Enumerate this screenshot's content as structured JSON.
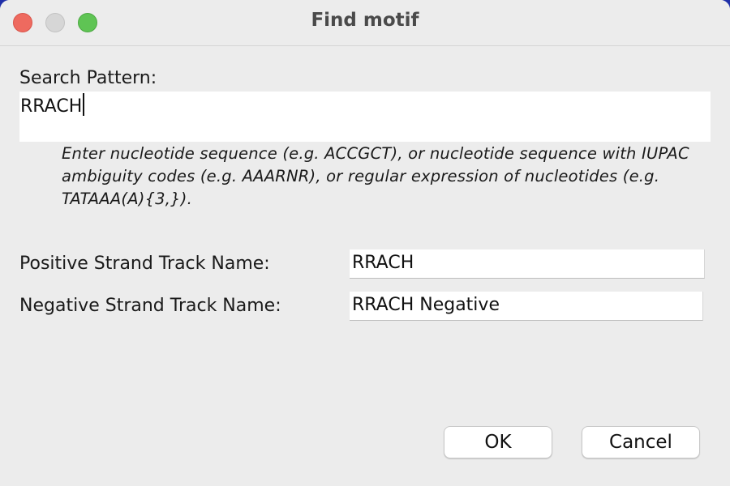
{
  "window": {
    "title": "Find motif",
    "controls": [
      "close",
      "minimize",
      "zoom"
    ]
  },
  "search": {
    "label": "Search Pattern:",
    "value": "RRACH",
    "hint": "Enter nucleotide sequence (e.g. ACCGCT),  or nucleotide sequence with IUPAC ambiguity codes (e.g. AAARNR),  or regular expression of nucleotides (e.g. TATAAA(A){3,})."
  },
  "positive_track": {
    "label": "Positive Strand Track Name:",
    "value": "RRACH"
  },
  "negative_track": {
    "label": "Negative Strand Track Name:",
    "value": "RRACH Negative"
  },
  "buttons": {
    "ok": "OK",
    "cancel": "Cancel"
  },
  "colors": {
    "close": "#ee6a5f",
    "minimize": "#d6d6d6",
    "zoom": "#5fc454",
    "window_bg": "#ececec"
  }
}
